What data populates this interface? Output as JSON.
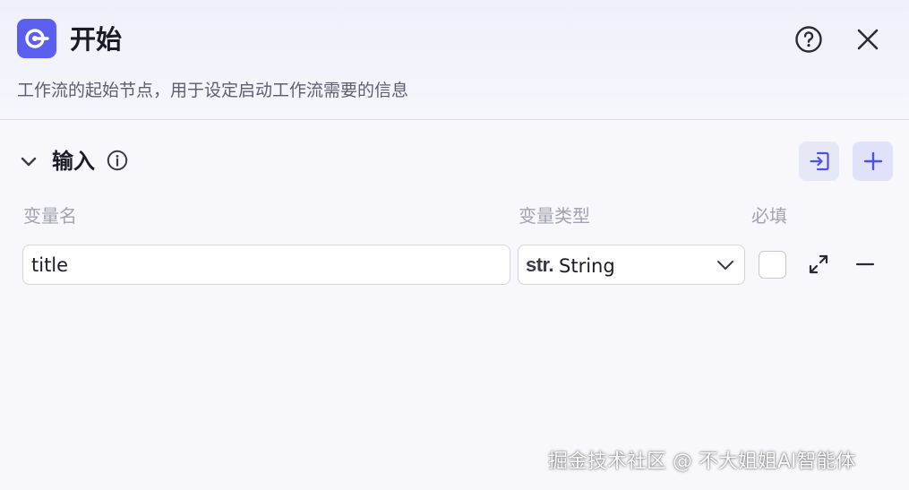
{
  "node": {
    "title": "开始",
    "description": "工作流的起始节点，用于设定启动工作流需要的信息",
    "icon": "start-node-icon"
  },
  "header_actions": {
    "help_icon": "question-circle-icon",
    "close_icon": "close-icon"
  },
  "input_section": {
    "title": "输入",
    "info_icon": "info-circle-icon",
    "import_icon": "import-icon",
    "add_icon": "plus-icon",
    "columns": {
      "name": "变量名",
      "type": "变量类型",
      "required": "必填"
    },
    "variables": [
      {
        "name": "title",
        "type_prefix": "str.",
        "type": "String",
        "required": false
      }
    ]
  },
  "watermark": "掘金技术社区 @ 不大姐姐AI智能体",
  "colors": {
    "accent": "#5b5ff0",
    "accent_light": "#e1e2f9",
    "background": "#f7f7fc",
    "muted_text": "#a3a3b0"
  }
}
